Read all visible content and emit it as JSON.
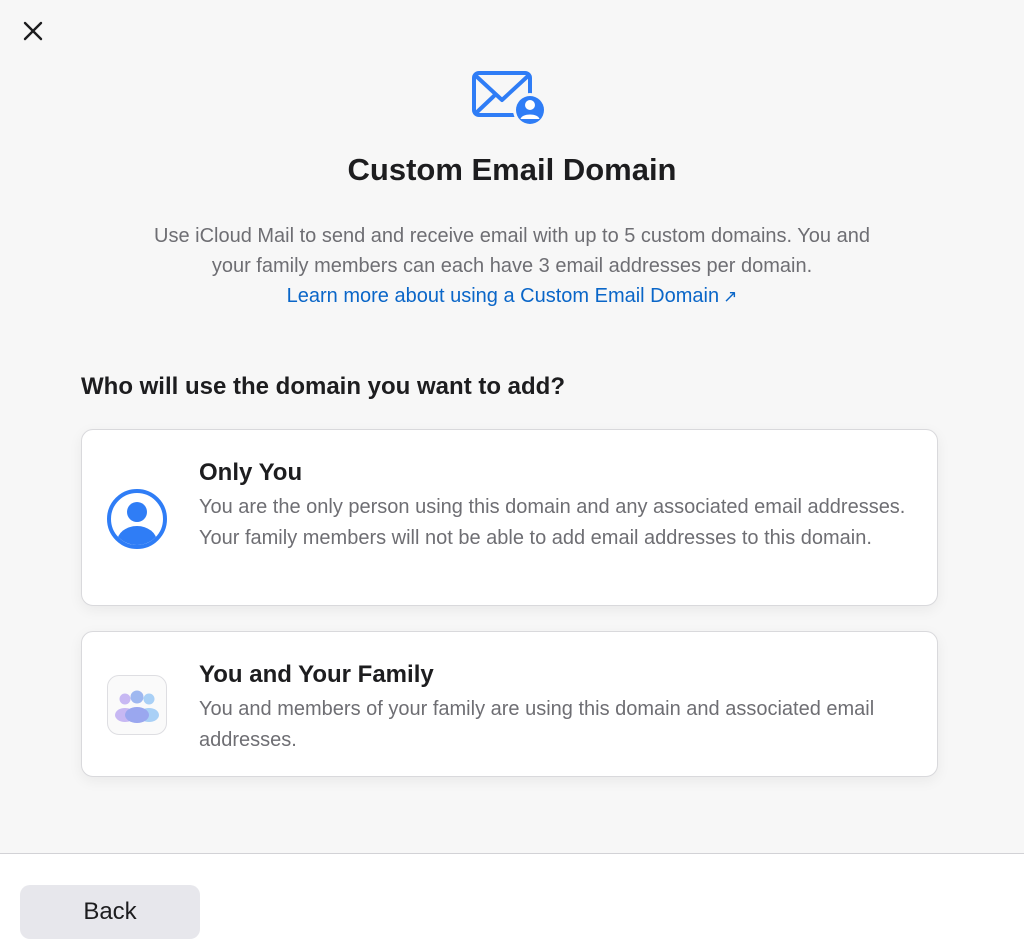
{
  "icons": {
    "close": "close-icon",
    "hero": "mail-person-icon",
    "only_you": "person-circle-icon",
    "family": "family-group-icon",
    "link_arrow": "arrow-up-right-icon"
  },
  "colors": {
    "accent": "#2f7df6",
    "link": "#0a66c8",
    "family_purple": "#b5a6ef",
    "family_blue": "#8fc3f4"
  },
  "header": {
    "title": "Custom Email Domain",
    "description_line1": "Use iCloud Mail to send and receive email with up to 5 custom domains. You and",
    "description_line2": "your family members can each have 3 email addresses per domain.",
    "learn_more": "Learn more about using a Custom Email Domain",
    "learn_more_arrow": "↗"
  },
  "question": "Who will use the domain you want to add?",
  "options": [
    {
      "title": "Only You",
      "description": "You are the only person using this domain and any associated email addresses. Your family members will not be able to add email addresses to this domain."
    },
    {
      "title": "You and Your Family",
      "description": "You and members of your family are using this domain and associated email addresses."
    }
  ],
  "footer": {
    "back_label": "Back"
  }
}
